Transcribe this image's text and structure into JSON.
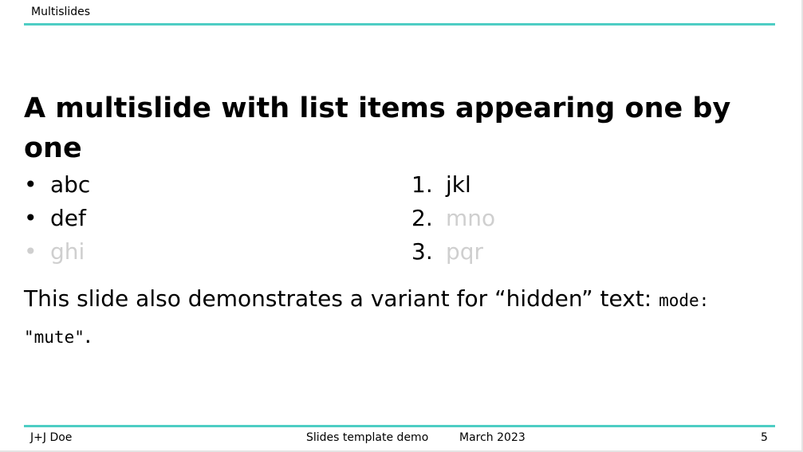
{
  "header": {
    "title": "Multislides"
  },
  "slide": {
    "title": "A multislide with list items appearing one by one",
    "bullets": [
      {
        "marker": "•",
        "text": "abc",
        "muted": false
      },
      {
        "marker": "•",
        "text": "def",
        "muted": false
      },
      {
        "marker": "•",
        "text": "ghi",
        "muted": true
      }
    ],
    "numbered": [
      {
        "marker": "1.",
        "text": "jkl",
        "muted": false
      },
      {
        "marker": "2.",
        "text": "mno",
        "muted": true
      },
      {
        "marker": "3.",
        "text": "pqr",
        "muted": true
      }
    ],
    "paragraph": {
      "text": "This slide also demonstrates a variant for “hidden” text: ",
      "code": "mode: \"mute\"",
      "end": "."
    }
  },
  "footer": {
    "author": "J+J Doe",
    "event": "Slides template demo",
    "date": "March 2023",
    "page": "5"
  },
  "colors": {
    "accent": "#4ecdc4",
    "muted_text": "#cfcfcf"
  }
}
